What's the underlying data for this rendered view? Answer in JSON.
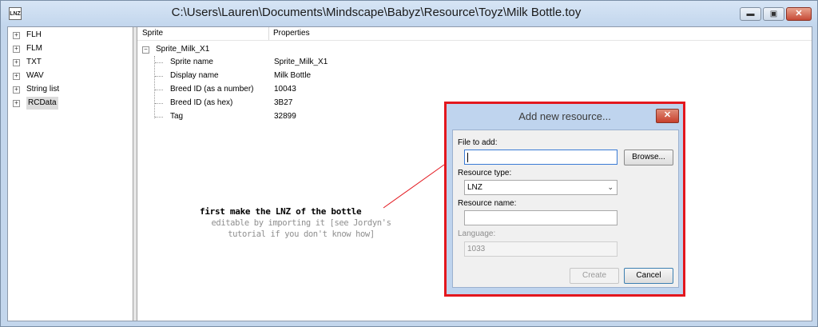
{
  "window": {
    "title": "C:\\Users\\Lauren\\Documents\\Mindscape\\Babyz\\Resource\\Toyz\\Milk Bottle.toy",
    "icon_label": "LNZ",
    "controls": {
      "minimize": "▬",
      "maximize": "▣",
      "close": "✕"
    }
  },
  "tree": {
    "items": [
      {
        "label": "FLH"
      },
      {
        "label": "FLM"
      },
      {
        "label": "TXT"
      },
      {
        "label": "WAV"
      },
      {
        "label": "String list"
      },
      {
        "label": "RCData"
      }
    ],
    "expander_glyph": "+"
  },
  "details": {
    "headers": {
      "col1": "Sprite",
      "col2": "Properties"
    },
    "root": "Sprite_Milk_X1",
    "root_expander": "−",
    "rows": [
      {
        "name": "Sprite name",
        "value": "Sprite_Milk_X1"
      },
      {
        "name": "Display name",
        "value": "Milk Bottle"
      },
      {
        "name": "Breed ID (as a number)",
        "value": "10043"
      },
      {
        "name": "Breed ID (as hex)",
        "value": "3B27"
      },
      {
        "name": "Tag",
        "value": "32899"
      }
    ]
  },
  "annotation": {
    "line1": "first make the LNZ of the bottle",
    "line2": "editable by importing it [see Jordyn's",
    "line3": "tutorial if you don't know how]",
    "highlight_color": "#e3171e"
  },
  "dialog": {
    "title": "Add new resource...",
    "close_glyph": "✕",
    "file_label": "File to add:",
    "file_value": "",
    "browse_label": "Browse...",
    "type_label": "Resource type:",
    "type_value": "LNZ",
    "type_arrow": "⌄",
    "name_label": "Resource name:",
    "name_value": "",
    "language_label": "Language:",
    "language_value": "1033",
    "create_label": "Create",
    "cancel_label": "Cancel"
  }
}
